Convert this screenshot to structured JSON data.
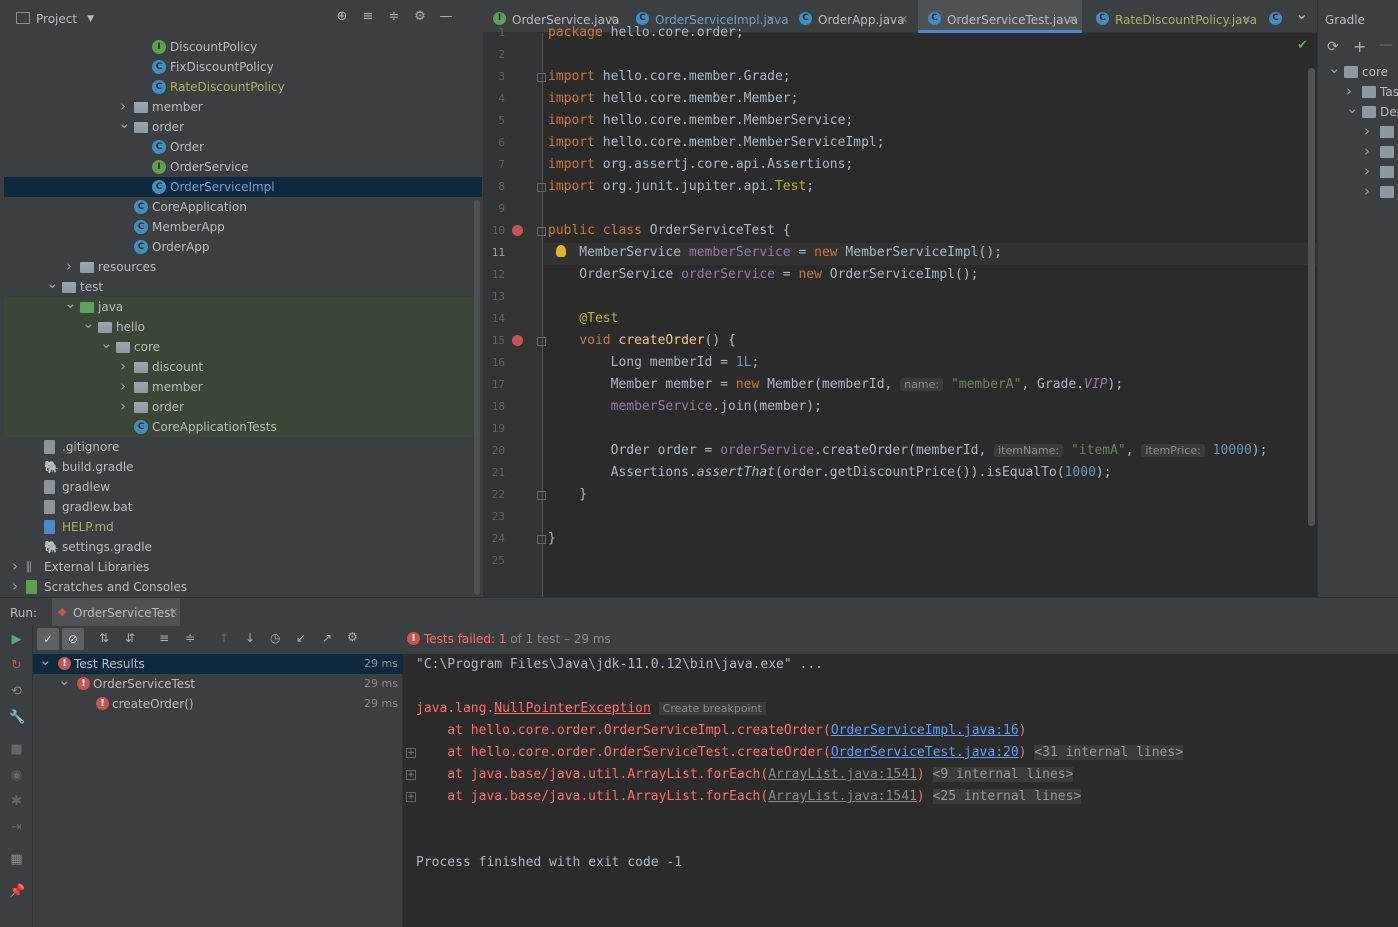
{
  "project_panel": {
    "title": "Project",
    "tree": [
      {
        "label": "DiscountPolicy",
        "icon": "interface",
        "depth": 8,
        "expander": ""
      },
      {
        "label": "FixDiscountPolicy",
        "icon": "class",
        "depth": 8,
        "expander": ""
      },
      {
        "label": "RateDiscountPolicy",
        "icon": "class",
        "depth": 8,
        "expander": "",
        "color": "#a4b55a"
      },
      {
        "label": "member",
        "icon": "folder",
        "depth": 7,
        "expander": "collapsed"
      },
      {
        "label": "order",
        "icon": "folder",
        "depth": 7,
        "expander": "expanded"
      },
      {
        "label": "Order",
        "icon": "class",
        "depth": 8,
        "expander": ""
      },
      {
        "label": "OrderService",
        "icon": "interface",
        "depth": 8,
        "expander": ""
      },
      {
        "label": "OrderServiceImpl",
        "icon": "class",
        "depth": 8,
        "expander": "",
        "selected": true
      },
      {
        "label": "CoreApplication",
        "icon": "class-run",
        "depth": 7,
        "expander": ""
      },
      {
        "label": "MemberApp",
        "icon": "class-run",
        "depth": 7,
        "expander": ""
      },
      {
        "label": "OrderApp",
        "icon": "class-run",
        "depth": 7,
        "expander": ""
      },
      {
        "label": "resources",
        "icon": "folder-res",
        "depth": 4,
        "expander": "collapsed"
      },
      {
        "label": "test",
        "icon": "folder",
        "depth": 3,
        "expander": "expanded"
      },
      {
        "label": "java",
        "icon": "folder-green",
        "depth": 4,
        "expander": "expanded"
      },
      {
        "label": "hello",
        "icon": "folder",
        "depth": 5,
        "expander": "expanded"
      },
      {
        "label": "core",
        "icon": "folder",
        "depth": 6,
        "expander": "expanded"
      },
      {
        "label": "discount",
        "icon": "folder",
        "depth": 7,
        "expander": "collapsed"
      },
      {
        "label": "member",
        "icon": "folder",
        "depth": 7,
        "expander": "collapsed"
      },
      {
        "label": "order",
        "icon": "folder",
        "depth": 7,
        "expander": "collapsed"
      },
      {
        "label": "CoreApplicationTests",
        "icon": "class-run",
        "depth": 7,
        "expander": ""
      },
      {
        "label": ".gitignore",
        "icon": "file",
        "depth": 2,
        "expander": ""
      },
      {
        "label": "build.gradle",
        "icon": "gradle",
        "depth": 2,
        "expander": ""
      },
      {
        "label": "gradlew",
        "icon": "file",
        "depth": 2,
        "expander": ""
      },
      {
        "label": "gradlew.bat",
        "icon": "file",
        "depth": 2,
        "expander": ""
      },
      {
        "label": "HELP.md",
        "icon": "md",
        "depth": 2,
        "expander": "",
        "color": "#a4b55a"
      },
      {
        "label": "settings.gradle",
        "icon": "gradle",
        "depth": 2,
        "expander": ""
      },
      {
        "label": "External Libraries",
        "icon": "libs",
        "depth": 1,
        "expander": "collapsed"
      },
      {
        "label": "Scratches and Consoles",
        "icon": "scratch",
        "depth": 1,
        "expander": "collapsed"
      }
    ]
  },
  "editor": {
    "tabs": [
      {
        "label": "OrderService.java",
        "icon": "interface",
        "active": false
      },
      {
        "label": "OrderServiceImpl.java",
        "icon": "class",
        "active": false,
        "color": "#6e9fd1"
      },
      {
        "label": "OrderApp.java",
        "icon": "class-run",
        "active": false
      },
      {
        "label": "OrderServiceTest.java",
        "icon": "class-run",
        "active": true
      },
      {
        "label": "RateDiscountPolicy.java",
        "icon": "class",
        "active": false,
        "color": "#a4b55a"
      }
    ],
    "current_line": "11",
    "lines": [
      {
        "n": "1",
        "html": "<span class='kw'>package</span> hello.core.order;"
      },
      {
        "n": "2",
        "html": ""
      },
      {
        "n": "3",
        "html": "<span class='kw'>import</span> hello.core.member.Grade;"
      },
      {
        "n": "4",
        "html": "<span class='kw'>import</span> hello.core.member.Member;"
      },
      {
        "n": "5",
        "html": "<span class='kw'>import</span> hello.core.member.MemberService;"
      },
      {
        "n": "6",
        "html": "<span class='kw'>import</span> hello.core.member.MemberServiceImpl;"
      },
      {
        "n": "7",
        "html": "<span class='kw'>import</span> org.assertj.core.api.Assertions;"
      },
      {
        "n": "8",
        "html": "<span class='kw'>import</span> org.junit.jupiter.api.<span class='ann'>Test</span>;"
      },
      {
        "n": "9",
        "html": ""
      },
      {
        "n": "10",
        "html": "<span class='kw'>public class</span> OrderServiceTest {"
      },
      {
        "n": "11",
        "html": "    MemberService <span class='fld'>memberService</span> = <span class='kw'>new</span> MemberServiceImpl();"
      },
      {
        "n": "12",
        "html": "    OrderService <span class='fld'>orderService</span> = <span class='kw'>new</span> OrderServiceImpl();"
      },
      {
        "n": "13",
        "html": ""
      },
      {
        "n": "14",
        "html": "    <span class='ann'>@Test</span>"
      },
      {
        "n": "15",
        "html": "    <span class='kw'>void</span> <span class='fn'>createOrder</span>() {"
      },
      {
        "n": "16",
        "html": "        Long memberId = <span class='num'>1L</span>;"
      },
      {
        "n": "17",
        "html": "        Member member = <span class='kw'>new</span> Member(memberId, <span class='hint'>name:</span> <span class='str'>\"memberA\"</span>, Grade.<span class='fld it'>VIP</span>);"
      },
      {
        "n": "18",
        "html": "        <span class='fld'>memberService</span>.join(member);"
      },
      {
        "n": "19",
        "html": ""
      },
      {
        "n": "20",
        "html": "        Order order = <span class='fld'>orderService</span>.createOrder(memberId, <span class='hint'>itemName:</span> <span class='str'>\"itemA\"</span>, <span class='hint'>itemPrice:</span> <span class='num'>10000</span>);"
      },
      {
        "n": "21",
        "html": "        Assertions.<span class='it'>assertThat</span>(order.getDiscountPrice()).isEqualTo(<span class='num'>1000</span>);"
      },
      {
        "n": "22",
        "html": "    }"
      },
      {
        "n": "23",
        "html": ""
      },
      {
        "n": "24",
        "html": "}"
      },
      {
        "n": "25",
        "html": ""
      }
    ]
  },
  "gradle_panel": {
    "title": "Gradle",
    "items": [
      {
        "label": "core",
        "icon": "gradle-elephant"
      },
      {
        "label": "Tas",
        "icon": "tasks-folder"
      },
      {
        "label": "Dep",
        "icon": "deps-folder"
      },
      {
        "label": "",
        "icon": "dep"
      },
      {
        "label": "",
        "icon": "dep"
      },
      {
        "label": "",
        "icon": "dep"
      },
      {
        "label": "",
        "icon": "dep"
      }
    ]
  },
  "run_panel": {
    "label": "Run:",
    "tab": "OrderServiceTest",
    "status_prefix": "Tests failed: ",
    "status_count": "1",
    "status_suffix": " of 1 test – 29 ms",
    "tests": [
      {
        "label": "Test Results",
        "time": "29 ms",
        "depth": 0
      },
      {
        "label": "OrderServiceTest",
        "time": "29 ms",
        "depth": 1
      },
      {
        "label": "createOrder()",
        "time": "29 ms",
        "depth": 2
      }
    ],
    "console": [
      {
        "html": "<span style='color:#a9b7c6'>\"C:\\Program Files\\Java\\jdk-11.0.12\\bin\\java.exe\" ...</span>",
        "fold": false
      },
      {
        "html": "",
        "fold": false
      },
      {
        "html": "<span class='red'>java.lang.</span><span class='link2' style='color:#ff6b68'>NullPointerException</span> <span class='bp'>Create breakpoint</span>",
        "fold": false
      },
      {
        "html": "<span class='red'>    at hello.core.order.OrderServiceImpl.createOrder(</span><span class='link'>OrderServiceImpl.java:16</span><span class='red'>)</span>",
        "fold": false
      },
      {
        "html": "<span class='red'>    at hello.core.order.OrderServiceTest.createOrder(</span><span class='link'>OrderServiceTest.java:20</span><span class='red'>)</span> <span class='fold'>&lt;31 internal lines&gt;</span>",
        "fold": true
      },
      {
        "html": "<span class='red'>    at java.base/java.util.ArrayList.forEach(</span><span class='link2'>ArrayList.java:1541</span><span class='red'>)</span> <span class='fold'>&lt;9 internal lines&gt;</span>",
        "fold": true
      },
      {
        "html": "<span class='red'>    at java.base/java.util.ArrayList.forEach(</span><span class='link2'>ArrayList.java:1541</span><span class='red'>)</span> <span class='fold'>&lt;25 internal lines&gt;</span>",
        "fold": true
      },
      {
        "html": "",
        "fold": false
      },
      {
        "html": "",
        "fold": false
      },
      {
        "html": "<span style='color:#a9b7c6'>Process finished with exit code -1</span>",
        "fold": false
      }
    ]
  }
}
